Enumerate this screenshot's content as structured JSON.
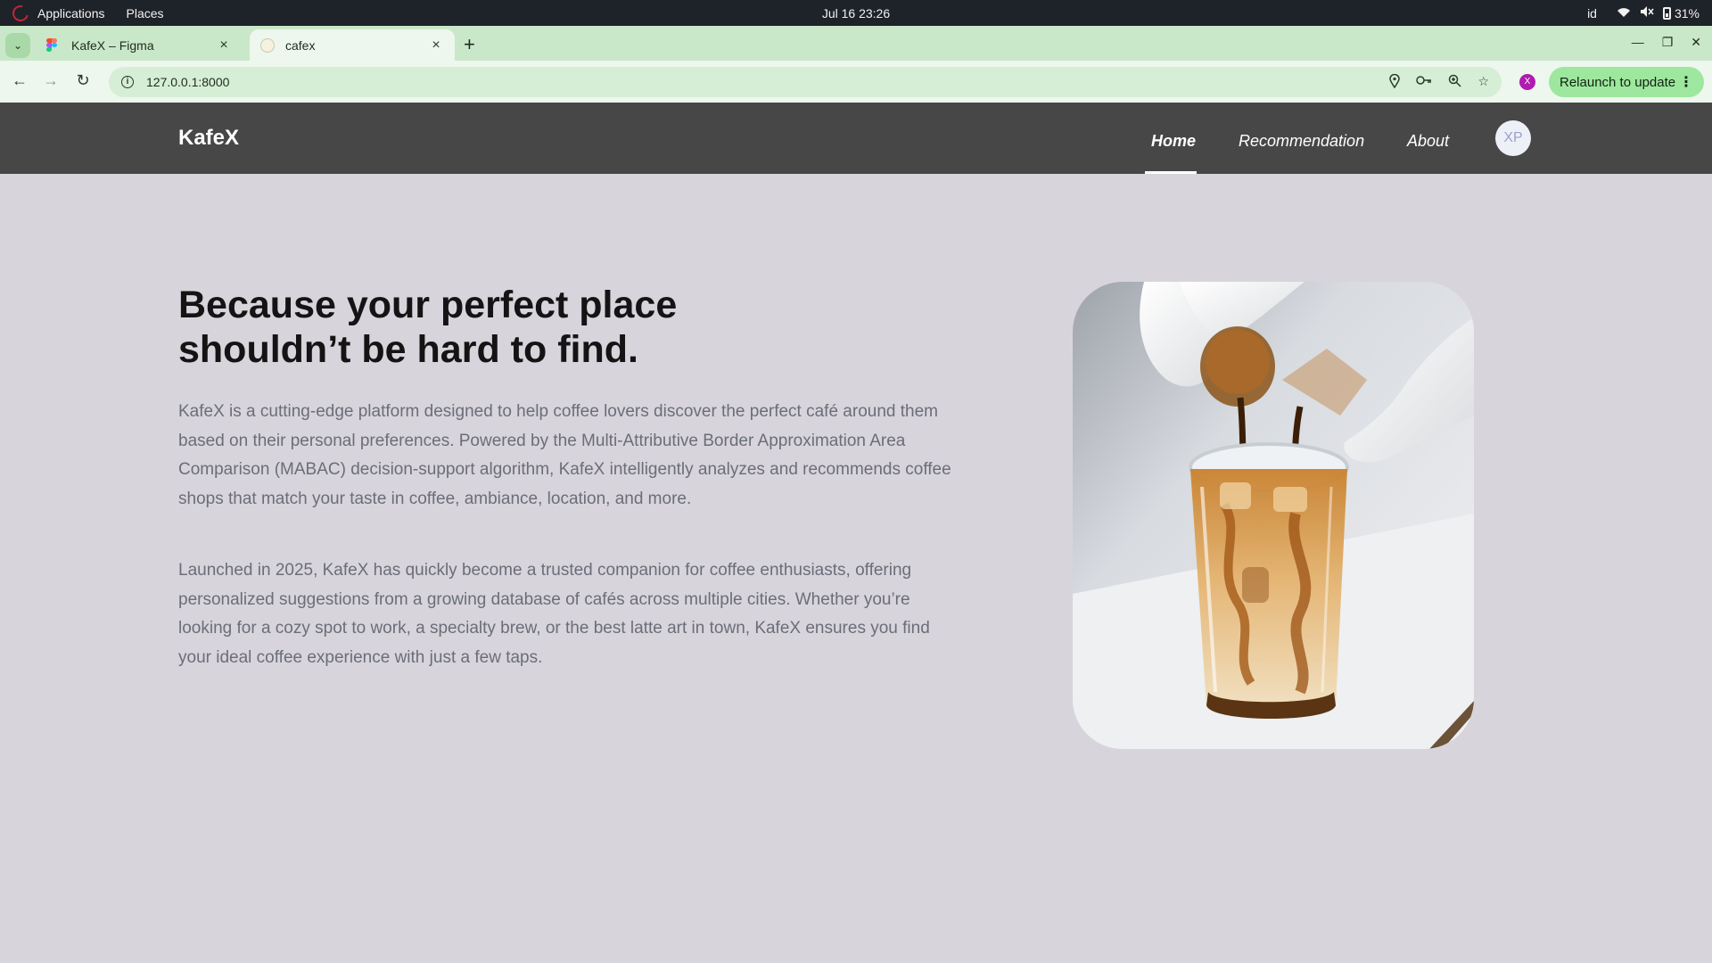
{
  "os_bar": {
    "applications": "Applications",
    "places": "Places",
    "datetime": "Jul 16  23:26",
    "keyboard_layout": "id",
    "battery": "31%"
  },
  "browser": {
    "tabs": [
      {
        "title": "KafeX – Figma",
        "active": false,
        "favicon": "figma-icon"
      },
      {
        "title": "cafex",
        "active": true,
        "favicon": "cafex-favicon"
      }
    ],
    "url": "127.0.0.1:8000",
    "profile_initial": "X",
    "relaunch_label": "Relaunch to update"
  },
  "site": {
    "brand": "KafeX",
    "nav": {
      "home": "Home",
      "recommendation": "Recommendation",
      "about": "About"
    },
    "active_nav": "home",
    "avatar_initials": "XP"
  },
  "hero": {
    "title": "Because your perfect place shouldn’t be hard to find.",
    "paragraph1": "KafeX is a cutting-edge platform designed to help coffee lovers discover the perfect café around them based on their personal preferences. Powered by the Multi-Attributive Border Approximation Area Comparison (MABAC) decision-support algorithm, KafeX intelligently analyzes and recommends coffee shops that match your taste in coffee, ambiance, location, and more.",
    "paragraph2": "Launched in 2025, KafeX has quickly become a trusted companion for coffee enthusiasts, offering personalized suggestions from a growing database of cafés across multiple cities. Whether you’re looking for a cozy spot to work, a specialty brew, or the best latte art in town, KafeX ensures you find your ideal coffee experience with just a few taps."
  },
  "colors": {
    "page_bg": "#d8d4dc",
    "navbar_bg": "#474747",
    "tabstrip_bg": "#c9e8c9",
    "relaunch_bg": "#9ee79e"
  }
}
